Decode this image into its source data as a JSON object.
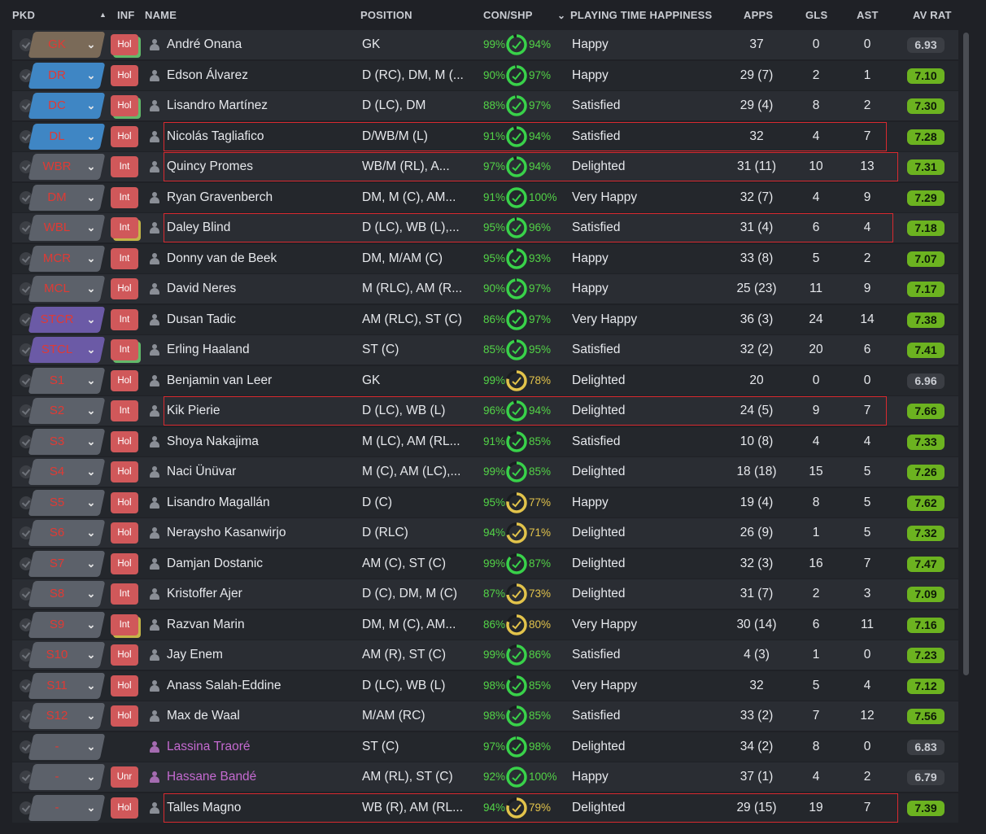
{
  "headers": {
    "pkd": "PKD",
    "inf": "INF",
    "name": "NAME",
    "position": "POSITION",
    "con_shp": "CON/SHP",
    "playing_time_happiness": "PLAYING TIME HAPPINESS",
    "apps": "APPS",
    "gls": "GLS",
    "ast": "AST",
    "av_rat": "AV RAT"
  },
  "colors": {
    "gk": "#7a6a58",
    "def": "#3f86c4",
    "grey": "#5c616a",
    "purple": "#6b5aa6",
    "rating_green": "#6cb320",
    "highlight_border": "#d82a30"
  },
  "players": [
    {
      "pos": "GK",
      "pos_style": "gk",
      "inf": "Hol",
      "inf_stack": "green",
      "name": "André Onana",
      "position": "GK",
      "con": "99%",
      "shp": "94%",
      "shp_level": 0.94,
      "happiness": "Happy",
      "apps": "37",
      "gls": "0",
      "ast": "0",
      "rating": "6.93",
      "rating_style": "grey",
      "highlight": false
    },
    {
      "pos": "DR",
      "pos_style": "def",
      "inf": "Hol",
      "inf_stack": "",
      "name": "Edson Álvarez",
      "position": "D (RC), DM, M (...",
      "con": "90%",
      "shp": "97%",
      "shp_level": 0.97,
      "happiness": "Happy",
      "apps": "29 (7)",
      "gls": "2",
      "ast": "1",
      "rating": "7.10",
      "rating_style": "green",
      "highlight": false
    },
    {
      "pos": "DC",
      "pos_style": "def",
      "inf": "Hol",
      "inf_stack": "green",
      "name": "Lisandro Martínez",
      "position": "D (LC), DM",
      "con": "88%",
      "shp": "97%",
      "shp_level": 0.97,
      "happiness": "Satisfied",
      "apps": "29 (4)",
      "gls": "8",
      "ast": "2",
      "rating": "7.30",
      "rating_style": "green",
      "highlight": false
    },
    {
      "pos": "DL",
      "pos_style": "def",
      "inf": "Hol",
      "inf_stack": "",
      "name": "Nicolás Tagliafico",
      "position": "D/WB/M (L)",
      "con": "91%",
      "shp": "94%",
      "shp_level": 0.94,
      "happiness": "Satisfied",
      "apps": "32",
      "gls": "4",
      "ast": "7",
      "rating": "7.28",
      "rating_style": "green",
      "highlight": "short"
    },
    {
      "pos": "WBR",
      "pos_style": "grey",
      "inf": "Int",
      "inf_stack": "",
      "name": "Quincy Promes",
      "position": "WB/M (RL), A...",
      "con": "97%",
      "shp": "94%",
      "shp_level": 0.94,
      "happiness": "Delighted",
      "apps": "31 (11)",
      "gls": "10",
      "ast": "13",
      "rating": "7.31",
      "rating_style": "green",
      "highlight": "long"
    },
    {
      "pos": "DM",
      "pos_style": "grey",
      "inf": "Int",
      "inf_stack": "",
      "name": "Ryan Gravenberch",
      "position": "DM, M (C), AM...",
      "con": "91%",
      "shp": "100%",
      "shp_level": 1.0,
      "happiness": "Very Happy",
      "apps": "32 (7)",
      "gls": "4",
      "ast": "9",
      "rating": "7.29",
      "rating_style": "green",
      "highlight": false
    },
    {
      "pos": "WBL",
      "pos_style": "grey",
      "inf": "Int",
      "inf_stack": "yellow",
      "name": "Daley Blind",
      "position": "D (LC), WB (L),...",
      "con": "95%",
      "shp": "96%",
      "shp_level": 0.96,
      "happiness": "Satisfied",
      "apps": "31 (4)",
      "gls": "6",
      "ast": "4",
      "rating": "7.18",
      "rating_style": "green",
      "highlight": "mid"
    },
    {
      "pos": "MCR",
      "pos_style": "grey",
      "inf": "Int",
      "inf_stack": "",
      "name": "Donny van de Beek",
      "position": "DM, M/AM (C)",
      "con": "95%",
      "shp": "93%",
      "shp_level": 0.93,
      "happiness": "Happy",
      "apps": "33 (8)",
      "gls": "5",
      "ast": "2",
      "rating": "7.07",
      "rating_style": "green",
      "highlight": false
    },
    {
      "pos": "MCL",
      "pos_style": "grey",
      "inf": "Hol",
      "inf_stack": "",
      "name": "David Neres",
      "position": "M (RLC), AM (R...",
      "con": "90%",
      "shp": "97%",
      "shp_level": 0.97,
      "happiness": "Happy",
      "apps": "25 (23)",
      "gls": "11",
      "ast": "9",
      "rating": "7.17",
      "rating_style": "green",
      "highlight": false
    },
    {
      "pos": "STCR",
      "pos_style": "purple",
      "inf": "Int",
      "inf_stack": "",
      "name": "Dusan Tadic",
      "position": "AM (RLC), ST (C)",
      "con": "86%",
      "shp": "97%",
      "shp_level": 0.97,
      "happiness": "Very Happy",
      "apps": "36 (3)",
      "gls": "24",
      "ast": "14",
      "rating": "7.38",
      "rating_style": "green",
      "highlight": false
    },
    {
      "pos": "STCL",
      "pos_style": "purple",
      "inf": "Int",
      "inf_stack": "green",
      "name": "Erling Haaland",
      "position": "ST (C)",
      "con": "85%",
      "shp": "95%",
      "shp_level": 0.95,
      "happiness": "Satisfied",
      "apps": "32 (2)",
      "gls": "20",
      "ast": "6",
      "rating": "7.41",
      "rating_style": "green",
      "highlight": false
    },
    {
      "pos": "S1",
      "pos_style": "grey",
      "inf": "Hol",
      "inf_stack": "",
      "name": "Benjamin van Leer",
      "position": "GK",
      "con": "99%",
      "shp": "78%",
      "shp_level": 0.78,
      "happiness": "Delighted",
      "apps": "20",
      "gls": "0",
      "ast": "0",
      "rating": "6.96",
      "rating_style": "grey",
      "highlight": false
    },
    {
      "pos": "S2",
      "pos_style": "grey",
      "inf": "Int",
      "inf_stack": "",
      "name": "Kik Pierie",
      "position": "D (LC), WB (L)",
      "con": "96%",
      "shp": "94%",
      "shp_level": 0.94,
      "happiness": "Delighted",
      "apps": "24 (5)",
      "gls": "9",
      "ast": "7",
      "rating": "7.66",
      "rating_style": "green",
      "highlight": "short"
    },
    {
      "pos": "S3",
      "pos_style": "grey",
      "inf": "Hol",
      "inf_stack": "",
      "name": "Shoya Nakajima",
      "position": "M (LC), AM (RL...",
      "con": "91%",
      "shp": "85%",
      "shp_level": 0.85,
      "happiness": "Satisfied",
      "apps": "10 (8)",
      "gls": "4",
      "ast": "4",
      "rating": "7.33",
      "rating_style": "green",
      "highlight": false
    },
    {
      "pos": "S4",
      "pos_style": "grey",
      "inf": "Hol",
      "inf_stack": "",
      "name": "Naci Ünüvar",
      "position": "M (C), AM (LC),...",
      "con": "99%",
      "shp": "85%",
      "shp_level": 0.85,
      "happiness": "Delighted",
      "apps": "18 (18)",
      "gls": "15",
      "ast": "5",
      "rating": "7.26",
      "rating_style": "green",
      "highlight": false
    },
    {
      "pos": "S5",
      "pos_style": "grey",
      "inf": "Hol",
      "inf_stack": "",
      "name": "Lisandro Magallán",
      "position": "D (C)",
      "con": "95%",
      "shp": "77%",
      "shp_level": 0.77,
      "happiness": "Happy",
      "apps": "19 (4)",
      "gls": "8",
      "ast": "5",
      "rating": "7.62",
      "rating_style": "green",
      "highlight": false
    },
    {
      "pos": "S6",
      "pos_style": "grey",
      "inf": "Hol",
      "inf_stack": "",
      "name": "Neraysho Kasanwirjo",
      "position": "D (RLC)",
      "con": "94%",
      "shp": "71%",
      "shp_level": 0.71,
      "happiness": "Delighted",
      "apps": "26 (9)",
      "gls": "1",
      "ast": "5",
      "rating": "7.32",
      "rating_style": "green",
      "highlight": false
    },
    {
      "pos": "S7",
      "pos_style": "grey",
      "inf": "Hol",
      "inf_stack": "",
      "name": "Damjan Dostanic",
      "position": "AM (C), ST (C)",
      "con": "99%",
      "shp": "87%",
      "shp_level": 0.87,
      "happiness": "Delighted",
      "apps": "32 (3)",
      "gls": "16",
      "ast": "7",
      "rating": "7.47",
      "rating_style": "green",
      "highlight": false
    },
    {
      "pos": "S8",
      "pos_style": "grey",
      "inf": "Int",
      "inf_stack": "",
      "name": "Kristoffer Ajer",
      "position": "D (C), DM, M (C)",
      "con": "87%",
      "shp": "73%",
      "shp_level": 0.73,
      "happiness": "Delighted",
      "apps": "31 (7)",
      "gls": "2",
      "ast": "3",
      "rating": "7.09",
      "rating_style": "green",
      "highlight": false
    },
    {
      "pos": "S9",
      "pos_style": "grey",
      "inf": "Int",
      "inf_stack": "yellow",
      "name": "Razvan Marin",
      "position": "DM, M (C), AM...",
      "con": "86%",
      "shp": "80%",
      "shp_level": 0.8,
      "happiness": "Very Happy",
      "apps": "30 (14)",
      "gls": "6",
      "ast": "11",
      "rating": "7.16",
      "rating_style": "green",
      "highlight": false
    },
    {
      "pos": "S10",
      "pos_style": "grey",
      "inf": "Hol",
      "inf_stack": "",
      "name": "Jay Enem",
      "position": "AM (R), ST (C)",
      "con": "99%",
      "shp": "86%",
      "shp_level": 0.86,
      "happiness": "Satisfied",
      "apps": "4 (3)",
      "gls": "1",
      "ast": "0",
      "rating": "7.23",
      "rating_style": "green",
      "highlight": false
    },
    {
      "pos": "S11",
      "pos_style": "grey",
      "inf": "Hol",
      "inf_stack": "",
      "name": "Anass Salah-Eddine",
      "position": "D (LC), WB (L)",
      "con": "98%",
      "shp": "85%",
      "shp_level": 0.85,
      "happiness": "Very Happy",
      "apps": "32",
      "gls": "5",
      "ast": "4",
      "rating": "7.12",
      "rating_style": "green",
      "highlight": false
    },
    {
      "pos": "S12",
      "pos_style": "grey",
      "inf": "Hol",
      "inf_stack": "",
      "name": "Max de Waal",
      "position": "M/AM (RC)",
      "con": "98%",
      "shp": "85%",
      "shp_level": 0.85,
      "happiness": "Satisfied",
      "apps": "33 (2)",
      "gls": "7",
      "ast": "12",
      "rating": "7.56",
      "rating_style": "green",
      "highlight": false
    },
    {
      "pos": "-",
      "pos_style": "grey",
      "inf": "",
      "inf_stack": "",
      "name": "Lassina Traoré",
      "position": "ST (C)",
      "con": "97%",
      "shp": "98%",
      "shp_level": 0.98,
      "happiness": "Delighted",
      "apps": "34 (2)",
      "gls": "8",
      "ast": "0",
      "rating": "6.83",
      "rating_style": "grey",
      "highlight": false,
      "loan": true
    },
    {
      "pos": "-",
      "pos_style": "grey",
      "inf": "Unr",
      "inf_stack": "",
      "name": "Hassane Bandé",
      "position": "AM (RL), ST (C)",
      "con": "92%",
      "shp": "100%",
      "shp_level": 1.0,
      "happiness": "Happy",
      "apps": "37 (1)",
      "gls": "4",
      "ast": "2",
      "rating": "6.79",
      "rating_style": "grey",
      "highlight": false,
      "loan": true
    },
    {
      "pos": "-",
      "pos_style": "grey",
      "inf": "Hol",
      "inf_stack": "",
      "name": "Talles Magno",
      "position": "WB (R), AM (RL...",
      "con": "94%",
      "shp": "79%",
      "shp_level": 0.79,
      "happiness": "Delighted",
      "apps": "29 (15)",
      "gls": "19",
      "ast": "7",
      "rating": "7.39",
      "rating_style": "green",
      "highlight": "long"
    }
  ]
}
